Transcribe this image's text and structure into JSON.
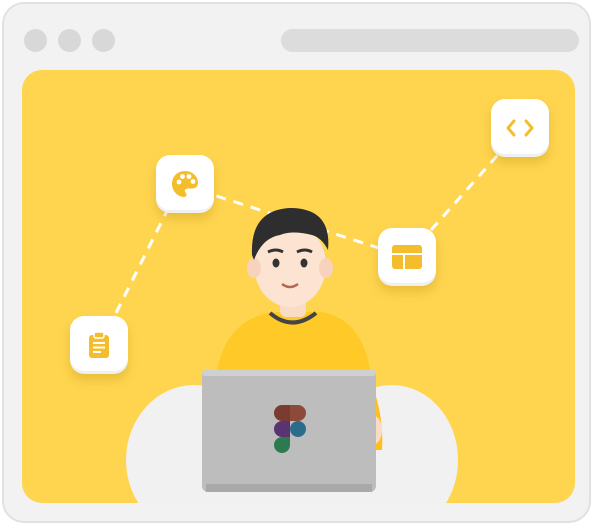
{
  "window": {
    "controls": [
      "close",
      "minimize",
      "maximize"
    ],
    "address_bar": ""
  },
  "colors": {
    "background": "#ffd54f",
    "accent": "#f4bd2b",
    "frame": "#f2f2f2",
    "shirt": "#ffc928",
    "laptop": "#bdbdbd"
  },
  "icons": {
    "clipboard": "clipboard-icon",
    "palette": "palette-icon",
    "layout": "layout-icon",
    "code": "code-icon",
    "figma": "figma-logo-icon"
  }
}
